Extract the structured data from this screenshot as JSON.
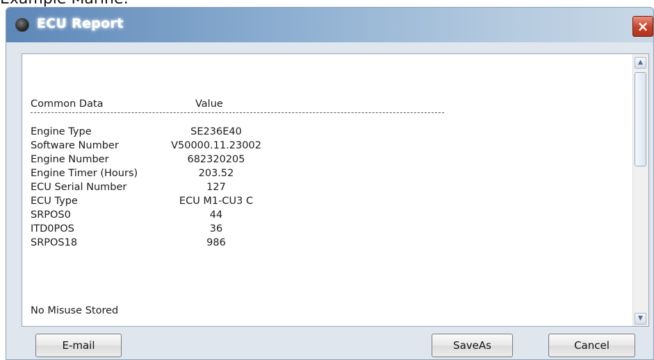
{
  "caption": "Example Marine:",
  "window": {
    "title": "ECU Report",
    "close_label": "×"
  },
  "report": {
    "header_key": "Common Data",
    "header_value": "Value",
    "rows": [
      {
        "label": "Engine Type",
        "value": "SE236E40"
      },
      {
        "label": "Software Number",
        "value": "V50000.11.23002"
      },
      {
        "label": "Engine Number",
        "value": "682320205"
      },
      {
        "label": "Engine Timer (Hours)",
        "value": "203.52"
      },
      {
        "label": "ECU Serial Number",
        "value": "127"
      },
      {
        "label": "ECU Type",
        "value": "ECU M1-CU3 C"
      },
      {
        "label": "SRPOS0",
        "value": "44"
      },
      {
        "label": "ITD0POS",
        "value": "36"
      },
      {
        "label": "SRPOS18",
        "value": "986"
      }
    ],
    "misuse_text": "No Misuse Stored"
  },
  "buttons": {
    "email": "E-mail",
    "saveas": "SaveAs",
    "cancel": "Cancel"
  },
  "icons": {
    "scroll_up": "▲",
    "scroll_down": "▼"
  }
}
